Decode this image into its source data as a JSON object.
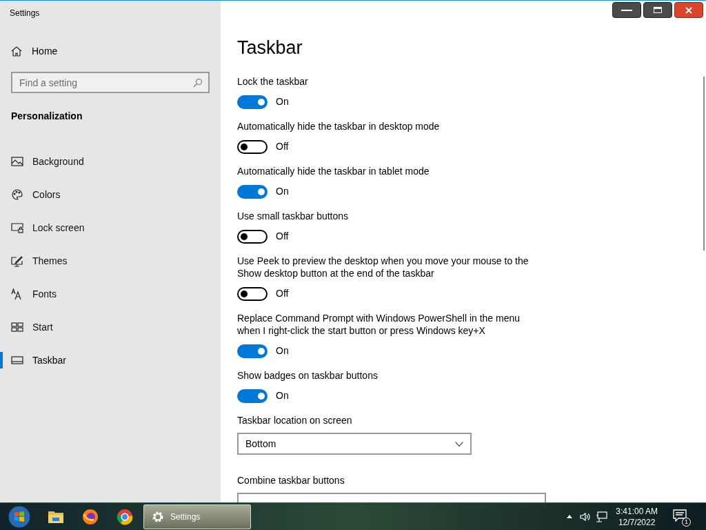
{
  "window": {
    "title": "Settings"
  },
  "sidebar": {
    "home": "Home",
    "search": {
      "placeholder": "Find a setting"
    },
    "section": "Personalization",
    "items": [
      {
        "label": "Background",
        "kind": "picture",
        "selected": false
      },
      {
        "label": "Colors",
        "kind": "palette",
        "selected": false
      },
      {
        "label": "Lock screen",
        "kind": "lock",
        "selected": false
      },
      {
        "label": "Themes",
        "kind": "themes",
        "selected": false
      },
      {
        "label": "Fonts",
        "kind": "fonts",
        "selected": false
      },
      {
        "label": "Start",
        "kind": "start",
        "selected": false
      },
      {
        "label": "Taskbar",
        "kind": "taskbar",
        "selected": true
      }
    ]
  },
  "content": {
    "title": "Taskbar",
    "settings": [
      {
        "kind": "toggle",
        "label": "Lock the taskbar",
        "on": true,
        "state": "On"
      },
      {
        "kind": "toggle",
        "label": "Automatically hide the taskbar in desktop mode",
        "on": false,
        "state": "Off"
      },
      {
        "kind": "toggle",
        "label": "Automatically hide the taskbar in tablet mode",
        "on": true,
        "state": "On"
      },
      {
        "kind": "toggle",
        "label": "Use small taskbar buttons",
        "on": false,
        "state": "Off"
      },
      {
        "kind": "toggle",
        "label": "Use Peek to preview the desktop when you move your mouse to the Show desktop button at the end of the taskbar",
        "on": false,
        "state": "Off"
      },
      {
        "kind": "toggle",
        "label": "Replace Command Prompt with Windows PowerShell in the menu when I right-click the start button or press Windows key+X",
        "on": true,
        "state": "On"
      },
      {
        "kind": "toggle",
        "label": "Show badges on taskbar buttons",
        "on": true,
        "state": "On"
      },
      {
        "kind": "dropdown",
        "label": "Taskbar location on screen",
        "value": "Bottom"
      },
      {
        "kind": "dropdown",
        "label": "Combine taskbar buttons"
      }
    ]
  },
  "taskbar": {
    "apps": [
      {
        "kind": "folder",
        "selected": false
      },
      {
        "kind": "firefox",
        "selected": false
      },
      {
        "kind": "chrome",
        "selected": false
      },
      {
        "kind": "settings",
        "label": "Settings",
        "selected": true
      }
    ],
    "time": "3:41:00 AM",
    "date": "12/7/2022",
    "notifications": "1"
  }
}
